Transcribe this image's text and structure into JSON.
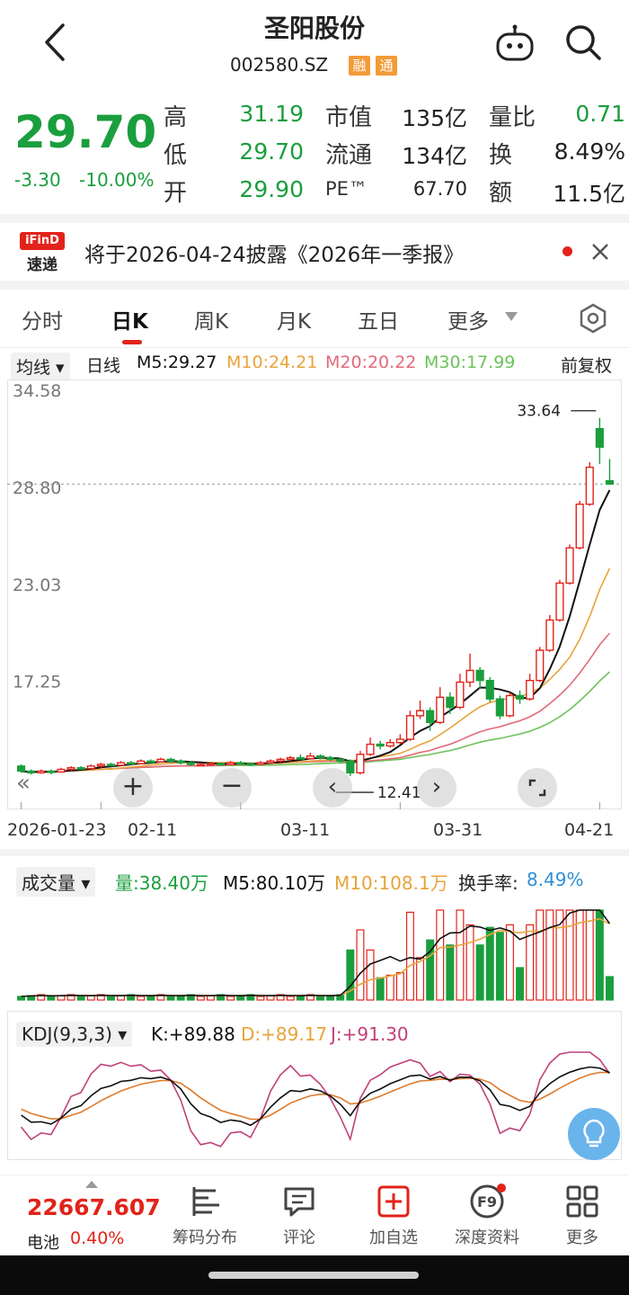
{
  "header": {
    "title": "圣阳股份",
    "code": "002580.SZ",
    "tags": [
      "融",
      "通"
    ]
  },
  "quote": {
    "price": "29.70",
    "change": "-3.30",
    "change_pct": "-10.00%",
    "rows": [
      {
        "l1": "高",
        "v1": "31.19",
        "l2": "市值",
        "v2": "135亿",
        "l3": "量比",
        "v3": "0.71"
      },
      {
        "l1": "低",
        "v1": "29.70",
        "l2": "流通",
        "v2": "134亿",
        "l3": "换",
        "v3": "8.49%"
      },
      {
        "l1": "开",
        "v1": "29.90",
        "l2": "PE™",
        "v2": "67.70",
        "l3": "额",
        "v3": "11.5亿"
      }
    ]
  },
  "notice": {
    "logo_top": "iFinD",
    "logo_bottom": "速递",
    "text": "将于2026-04-24披露《2026年一季报》"
  },
  "tabs": [
    "分时",
    "日K",
    "周K",
    "月K",
    "五日",
    "更多"
  ],
  "ma": {
    "selector": "均线",
    "period": "日线",
    "m5": "M5:29.27",
    "m10": "M10:24.21",
    "m20": "M20:20.22",
    "m30": "M30:17.99",
    "adjust": "前复权"
  },
  "colors": {
    "up": "#e2231a",
    "down": "#1b9e3e",
    "m5": "#111111",
    "m10": "#e8a33a",
    "m20": "#e26a7a",
    "m30": "#6cc35a",
    "accent": "#e2231a"
  },
  "chart_data": {
    "type": "candlestick",
    "y_ticks": [
      "34.58",
      "28.80",
      "23.03",
      "17.25"
    ],
    "x_ticks": [
      "2026-01-23",
      "02-11",
      "03-11",
      "03-31",
      "04-21"
    ],
    "ylim": [
      11.5,
      35.5
    ],
    "max_label": "33.64",
    "min_label": "12.41",
    "candles": [
      [
        12.9,
        12.6,
        13.0,
        12.5
      ],
      [
        12.6,
        12.5,
        12.7,
        12.4
      ],
      [
        12.5,
        12.6,
        12.7,
        12.45
      ],
      [
        12.6,
        12.55,
        12.7,
        12.41
      ],
      [
        12.55,
        12.7,
        12.8,
        12.5
      ],
      [
        12.7,
        12.8,
        12.9,
        12.6
      ],
      [
        12.8,
        12.75,
        12.9,
        12.7
      ],
      [
        12.75,
        12.9,
        13.0,
        12.7
      ],
      [
        12.9,
        13.0,
        13.1,
        12.8
      ],
      [
        13.0,
        12.95,
        13.1,
        12.9
      ],
      [
        12.95,
        13.1,
        13.2,
        12.9
      ],
      [
        13.1,
        13.05,
        13.2,
        13.0
      ],
      [
        13.05,
        13.2,
        13.3,
        13.0
      ],
      [
        13.2,
        13.15,
        13.3,
        13.1
      ],
      [
        13.15,
        13.3,
        13.4,
        13.1
      ],
      [
        13.3,
        13.2,
        13.4,
        13.1
      ],
      [
        13.2,
        13.1,
        13.3,
        13.0
      ],
      [
        13.1,
        13.0,
        13.2,
        12.9
      ],
      [
        13.0,
        13.0,
        13.1,
        12.9
      ],
      [
        13.0,
        13.05,
        13.1,
        12.95
      ],
      [
        13.05,
        13.0,
        13.1,
        12.95
      ],
      [
        13.0,
        13.1,
        13.2,
        12.95
      ],
      [
        13.1,
        13.05,
        13.2,
        13.0
      ],
      [
        13.05,
        13.0,
        13.1,
        12.9
      ],
      [
        13.0,
        13.1,
        13.2,
        12.95
      ],
      [
        13.1,
        13.2,
        13.3,
        13.05
      ],
      [
        13.2,
        13.3,
        13.4,
        13.1
      ],
      [
        13.3,
        13.4,
        13.5,
        13.2
      ],
      [
        13.4,
        13.35,
        13.6,
        13.3
      ],
      [
        13.35,
        13.5,
        13.7,
        13.3
      ],
      [
        13.5,
        13.4,
        13.6,
        13.3
      ],
      [
        13.4,
        13.3,
        13.5,
        13.2
      ],
      [
        13.3,
        13.2,
        13.4,
        13.1
      ],
      [
        13.2,
        12.5,
        13.3,
        12.3
      ],
      [
        12.5,
        13.6,
        13.8,
        12.4
      ],
      [
        13.6,
        14.2,
        14.6,
        13.5
      ],
      [
        14.2,
        14.1,
        14.4,
        13.9
      ],
      [
        14.1,
        14.3,
        14.5,
        14.0
      ],
      [
        14.3,
        14.5,
        14.8,
        14.2
      ],
      [
        14.5,
        15.9,
        16.2,
        14.4
      ],
      [
        15.9,
        16.2,
        16.8,
        15.7
      ],
      [
        16.2,
        15.5,
        16.4,
        15.0
      ],
      [
        15.5,
        17.0,
        17.6,
        15.4
      ],
      [
        17.0,
        16.4,
        17.3,
        16.0
      ],
      [
        16.4,
        17.9,
        18.4,
        16.3
      ],
      [
        17.9,
        18.6,
        19.6,
        17.6
      ],
      [
        18.6,
        18.0,
        18.8,
        17.5
      ],
      [
        18.0,
        16.9,
        18.2,
        16.7
      ],
      [
        16.9,
        15.9,
        17.1,
        15.7
      ],
      [
        15.9,
        17.1,
        17.3,
        15.8
      ],
      [
        17.1,
        16.9,
        17.4,
        16.6
      ],
      [
        16.9,
        18.0,
        18.4,
        16.8
      ],
      [
        18.0,
        19.8,
        20.0,
        17.9
      ],
      [
        19.8,
        21.6,
        21.9,
        19.7
      ],
      [
        21.6,
        23.8,
        24.0,
        21.5
      ],
      [
        23.8,
        25.9,
        26.1,
        23.7
      ],
      [
        25.9,
        28.5,
        28.7,
        25.8
      ],
      [
        28.5,
        30.7,
        31.0,
        28.4
      ],
      [
        33.0,
        31.9,
        33.64,
        30.9
      ],
      [
        29.9,
        29.7,
        31.19,
        29.7
      ]
    ],
    "volume": {
      "label": "成交量",
      "vol": "量:38.40万",
      "m5": "M5:80.10万",
      "m10": "M10:108.1万",
      "turnover_label": "换手率:",
      "turnover": "8.49%"
    },
    "kdj": {
      "label": "KDJ(9,3,3)",
      "k": "K:+89.88",
      "d": "D:+89.17",
      "j": "J:+91.30"
    }
  },
  "index": {
    "value": "22667.607",
    "name": "电池",
    "pct": "0.40%"
  },
  "bottom_nav": [
    "筹码分布",
    "评论",
    "加自选",
    "深度资料",
    "更多"
  ]
}
